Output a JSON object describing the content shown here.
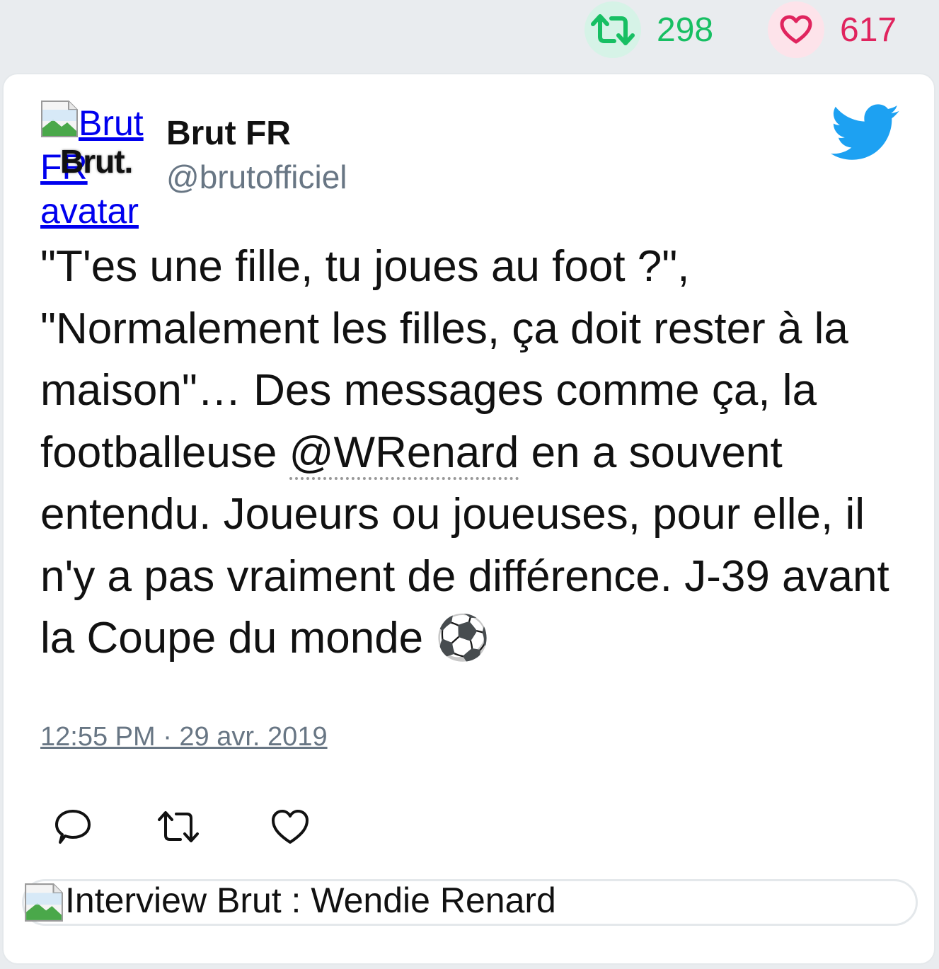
{
  "stats": {
    "retweets": "298",
    "likes": "617",
    "retweet_color": "#17bf63",
    "like_color": "#e0245e"
  },
  "tweet": {
    "avatar_alt": "Brut FR avatar",
    "avatar_logo_text": "Brut.",
    "display_name": "Brut FR",
    "handle": "@brutofficiel",
    "text_part1": "\"T'es une fille, tu joues au foot ?\", \"Normalement les filles, ça doit rester à la maison\"… Des messages comme ça, la footballeuse ",
    "mention": "@WRenard",
    "text_part2": " en a souvent entendu. Joueurs ou joueuses, pour elle, il n'y a pas vraiment de différence. J-39 avant la Coupe du monde ⚽",
    "timestamp": "12:55 PM · 29 avr. 2019",
    "link_card_title": "Interview Brut : Wendie Renard",
    "icons": {
      "brand": "twitter-bird-icon",
      "reply": "reply-icon",
      "retweet": "retweet-icon",
      "like": "heart-icon",
      "broken_image": "broken-image-icon"
    },
    "brand_color": "#1da1f2"
  }
}
